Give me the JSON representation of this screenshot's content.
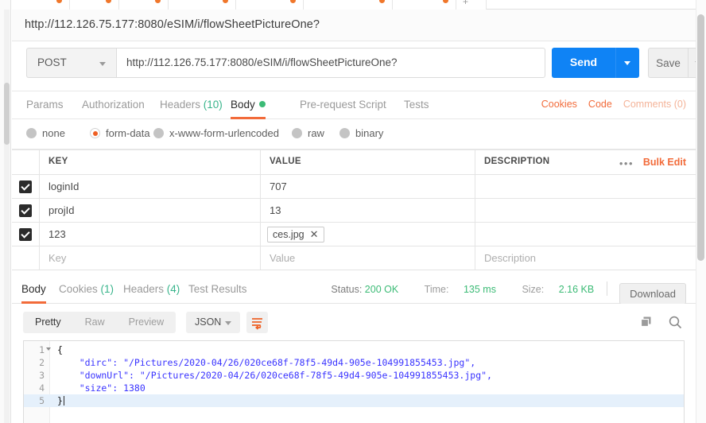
{
  "tabstrip": {
    "tabs": [
      {
        "label": "",
        "dot": true
      },
      {
        "label": "",
        "dot": true
      },
      {
        "label": "",
        "dot": true
      },
      {
        "label": "",
        "dot": true
      },
      {
        "label": "",
        "dot": true
      },
      {
        "label": "",
        "dot": true
      },
      {
        "label": "",
        "dot": true
      },
      {
        "label": "+",
        "dot": false
      }
    ]
  },
  "request": {
    "title": "http://112.126.75.177:8080/eSIM/i/flowSheetPictureOne?",
    "method": "POST",
    "url": "http://112.126.75.177:8080/eSIM/i/flowSheetPictureOne?",
    "send_label": "Send",
    "save_label": "Save",
    "tabs": [
      {
        "label": "Params",
        "count": "",
        "active": false
      },
      {
        "label": "Authorization",
        "count": "",
        "active": false
      },
      {
        "label": "Headers",
        "count": "(10)",
        "active": false
      },
      {
        "label": "Body",
        "count": "",
        "active": true
      },
      {
        "label": "Pre-request Script",
        "count": "",
        "active": false
      },
      {
        "label": "Tests",
        "count": "",
        "active": false
      }
    ],
    "links": [
      {
        "label": "Cookies",
        "dim": false
      },
      {
        "label": "Code",
        "dim": false
      },
      {
        "label": "Comments (0)",
        "dim": true
      }
    ],
    "body_types": [
      {
        "label": "none",
        "selected": false
      },
      {
        "label": "form-data",
        "selected": true
      },
      {
        "label": "x-www-form-urlencoded",
        "selected": false
      },
      {
        "label": "raw",
        "selected": false
      },
      {
        "label": "binary",
        "selected": false
      }
    ]
  },
  "table": {
    "headers": {
      "key": "KEY",
      "value": "VALUE",
      "description": "DESCRIPTION"
    },
    "dots_label": "•••",
    "bulk_edit_label": "Bulk Edit",
    "rows": [
      {
        "checked": true,
        "key": "loginId",
        "value": "707",
        "description": "",
        "is_file": false
      },
      {
        "checked": true,
        "key": "projId",
        "value": "13",
        "description": "",
        "is_file": false
      },
      {
        "checked": true,
        "key": "123",
        "value": "ces.jpg",
        "description": "",
        "is_file": true
      }
    ],
    "placeholder_row": {
      "key": "Key",
      "value": "Value",
      "description": "Description"
    }
  },
  "response": {
    "tabs": [
      {
        "label": "Body",
        "count": "",
        "active": true
      },
      {
        "label": "Cookies",
        "count": "(1)",
        "active": false
      },
      {
        "label": "Headers",
        "count": "(4)",
        "active": false
      },
      {
        "label": "Test Results",
        "count": "",
        "active": false
      }
    ],
    "status_label": "Status:",
    "status_value": "200 OK",
    "time_label": "Time:",
    "time_value": "135 ms",
    "size_label": "Size:",
    "size_value": "2.16 KB",
    "download_label": "Download",
    "format_tabs": [
      {
        "label": "Pretty",
        "active": true
      },
      {
        "label": "Raw",
        "active": false
      },
      {
        "label": "Preview",
        "active": false
      }
    ],
    "content_type": "JSON",
    "code_lines": [
      {
        "num": "1",
        "text": "{",
        "fold": true,
        "brace": true,
        "highlight": false
      },
      {
        "num": "2",
        "text": "    \"dirc\": \"/Pictures/2020-04/26/020ce68f-78f5-49d4-905e-104991855453.jpg\",",
        "fold": false,
        "brace": false,
        "highlight": false
      },
      {
        "num": "3",
        "text": "    \"downUrl\": \"/Pictures/2020-04/26/020ce68f-78f5-49d4-905e-104991855453.jpg\",",
        "fold": false,
        "brace": false,
        "highlight": false
      },
      {
        "num": "4",
        "text": "    \"size\": 1380",
        "fold": false,
        "brace": false,
        "highlight": false
      },
      {
        "num": "5",
        "text": "}",
        "fold": false,
        "brace": true,
        "highlight": true
      }
    ]
  },
  "colors": {
    "accent_orange": "#f26b3a",
    "send_blue": "#0f83f5",
    "status_green": "#3cbb76"
  }
}
